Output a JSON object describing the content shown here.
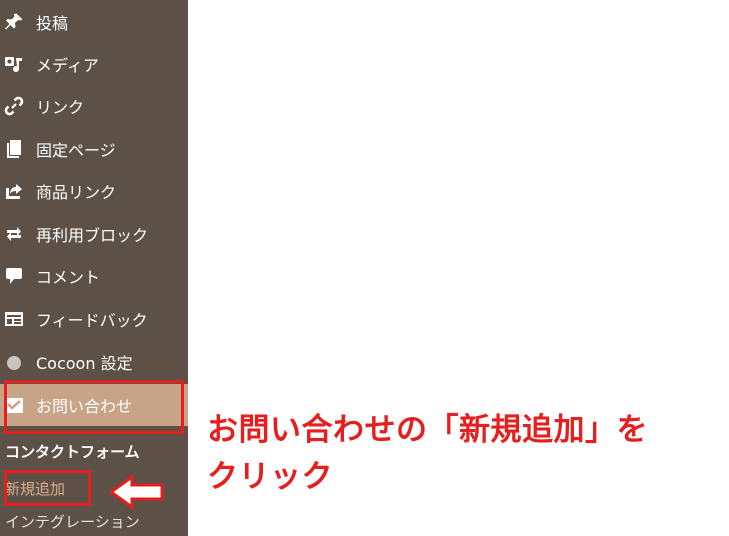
{
  "sidebar": {
    "items": [
      {
        "label": "投稿",
        "icon": "pushpin-icon"
      },
      {
        "label": "メディア",
        "icon": "media-icon"
      },
      {
        "label": "リンク",
        "icon": "link-icon"
      },
      {
        "label": "固定ページ",
        "icon": "pages-icon"
      },
      {
        "label": "商品リンク",
        "icon": "share-icon"
      },
      {
        "label": "再利用ブロック",
        "icon": "repeat-icon"
      },
      {
        "label": "コメント",
        "icon": "comment-icon"
      },
      {
        "label": "フィードバック",
        "icon": "feedback-icon"
      },
      {
        "label": "Cocoon 設定",
        "icon": "circle-icon"
      },
      {
        "label": "お問い合わせ",
        "icon": "mail-icon",
        "active": true
      }
    ],
    "submenu": {
      "title": "コンタクトフォーム",
      "items": [
        {
          "label": "新規追加",
          "current": true
        },
        {
          "label": "インテグレーション"
        }
      ]
    }
  },
  "annotation": {
    "line1": "お問い合わせの「新規追加」を",
    "line2": "クリック"
  },
  "colors": {
    "sidebar_bg": "#5c5047",
    "active_bg": "#c7a387",
    "highlight": "#e61e1e"
  }
}
